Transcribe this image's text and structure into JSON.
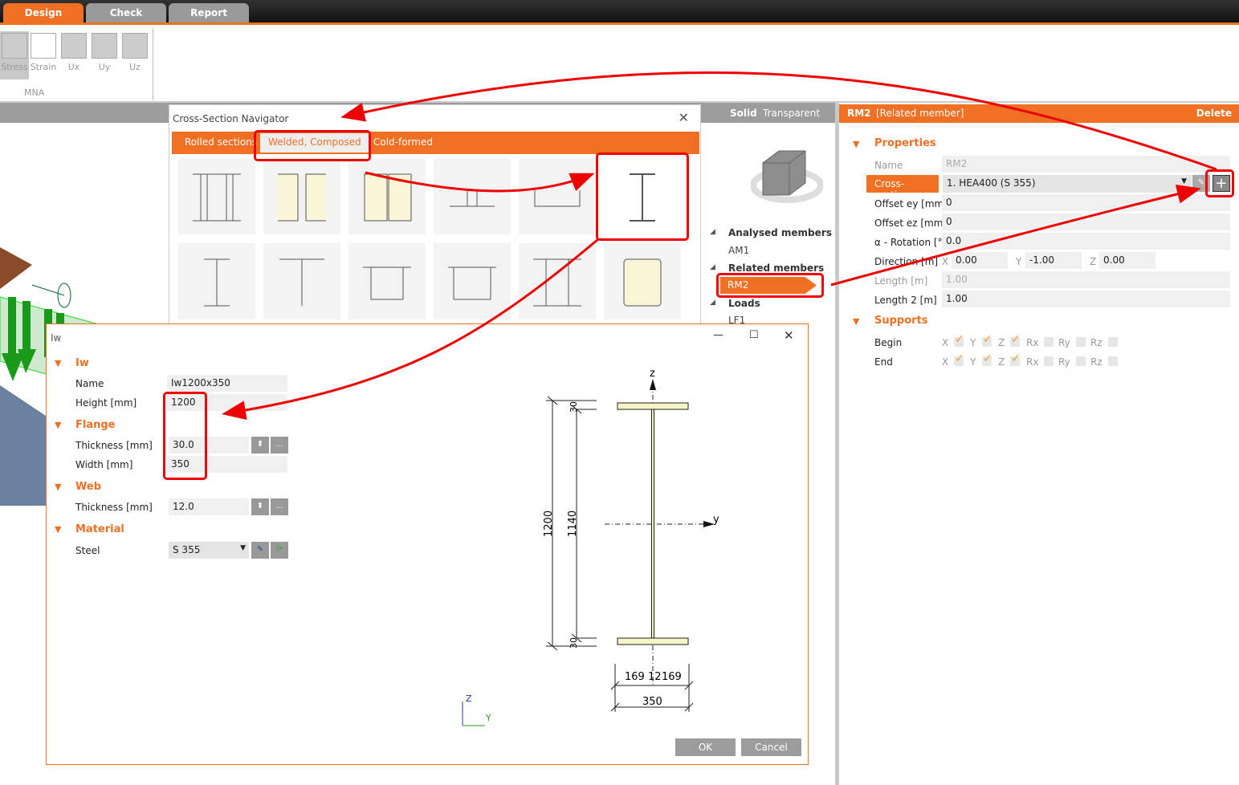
{
  "main_tabs": [
    {
      "label": "Design"
    },
    {
      "label": "Check"
    },
    {
      "label": "Report"
    }
  ],
  "ribbon": {
    "buttons": [
      {
        "label": "Stress"
      },
      {
        "label": "Strain"
      },
      {
        "label": "Ux"
      },
      {
        "label": "Uy"
      },
      {
        "label": "Uz"
      }
    ],
    "group_label": "MNA"
  },
  "navigator": {
    "title": "Cross-Section Navigator",
    "tabs": [
      {
        "label": "Rolled sections"
      },
      {
        "label": "Welded, Composed"
      },
      {
        "label": "Cold-formed"
      }
    ]
  },
  "view": {
    "solid": "Solid",
    "transparent": "Transparent"
  },
  "tree": {
    "analysed": "Analysed members",
    "am1": "AM1",
    "related": "Related members",
    "rm2": "RM2",
    "loads": "Loads",
    "lf1": "LF1"
  },
  "props": {
    "header_name": "RM2",
    "header_type": "[Related member]",
    "delete": "Delete",
    "properties": "Properties",
    "name_label": "Name",
    "name_value": "RM2",
    "cs_label": "Cross-section",
    "cs_value": "1. HEA400 (S 355)",
    "ey_label": "Offset ey [mm]",
    "ey_value": "0",
    "ez_label": "Offset ez [mm]",
    "ez_value": "0",
    "rot_label": "α - Rotation [°]",
    "rot_value": "0.0",
    "dir_label": "Direction [m]",
    "dir_x_label": "X",
    "dir_x": "0.00",
    "dir_y_label": "Y",
    "dir_y": "-1.00",
    "dir_z_label": "Z",
    "dir_z": "0.00",
    "len_label": "Length [m]",
    "len_value": "1.00",
    "len2_label": "Length 2 [m]",
    "len2_value": "1.00",
    "supports": "Supports",
    "begin": "Begin",
    "end": "End",
    "dofs": [
      "X",
      "Y",
      "Z",
      "Rx",
      "Ry",
      "Rz"
    ],
    "begin_checked": [
      true,
      true,
      true,
      false,
      false,
      false
    ],
    "end_checked": [
      true,
      true,
      true,
      false,
      false,
      false
    ]
  },
  "dialog": {
    "title": "Iw",
    "sec_iw": "Iw",
    "name_label": "Name",
    "name_value": "Iw1200x350",
    "height_label": "Height [mm]",
    "height_value": "1200",
    "sec_flange": "Flange",
    "ft_label": "Thickness [mm]",
    "ft_value": "30.0",
    "fw_label": "Width [mm]",
    "fw_value": "350",
    "sec_web": "Web",
    "wt_label": "Thickness [mm]",
    "wt_value": "12.0",
    "sec_material": "Material",
    "steel_label": "Steel",
    "steel_value": "S 355",
    "dots": "...",
    "ok": "OK",
    "cancel": "Cancel"
  },
  "drawing": {
    "z": "z",
    "y": "y",
    "h_total": "1200",
    "h_web": "1140",
    "tf_top": "30",
    "tf_bot": "30",
    "b_left": "169",
    "tw": "12",
    "b_right": "169",
    "b_total": "350",
    "axis_z": "Z",
    "axis_y": "Y"
  },
  "colors": {
    "accent": "#f07023",
    "annotation": "#e00000"
  }
}
